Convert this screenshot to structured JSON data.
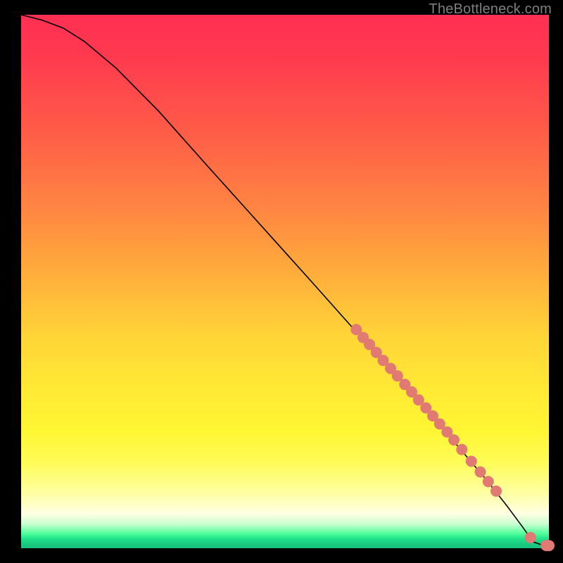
{
  "watermark": "TheBottleneck.com",
  "chart_data": {
    "type": "line",
    "title": "",
    "xlabel": "",
    "ylabel": "",
    "xlim": [
      0,
      100
    ],
    "ylim": [
      0,
      100
    ],
    "line": {
      "name": "bottleneck-curve",
      "x": [
        0,
        4,
        8,
        12,
        18,
        26,
        35,
        45,
        55,
        64,
        70,
        76,
        82,
        88,
        92,
        95,
        97,
        99,
        100
      ],
      "y": [
        100,
        99,
        97.5,
        95,
        90,
        82,
        72,
        61,
        50,
        40,
        34,
        27,
        20,
        13,
        8,
        4,
        1.2,
        0.5,
        0.5
      ]
    },
    "series": [
      {
        "name": "scatter-points",
        "x": [
          63.5,
          64.8,
          66.0,
          67.3,
          68.6,
          70.0,
          71.3,
          72.7,
          74.0,
          75.3,
          76.7,
          78.0,
          79.3,
          80.7,
          82.0,
          83.5,
          85.3,
          87.0,
          88.5,
          90.0,
          96.5,
          99.5,
          100.0
        ],
        "y": [
          41.0,
          39.5,
          38.2,
          36.7,
          35.2,
          33.7,
          32.3,
          30.7,
          29.3,
          27.8,
          26.3,
          24.8,
          23.3,
          21.8,
          20.3,
          18.5,
          16.3,
          14.3,
          12.5,
          10.7,
          2.0,
          0.5,
          0.5
        ]
      }
    ],
    "colors": {
      "line": "#000000",
      "dots": "#e07a73",
      "gradient_top": "#ff2f52",
      "gradient_mid": "#ffe934",
      "gradient_bottom": "#17c07d"
    }
  }
}
